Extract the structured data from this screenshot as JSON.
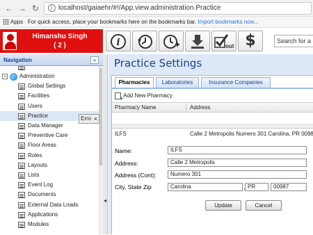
{
  "browser": {
    "url": "localhost/gaiaehr/#!/App.view.administration.Practice",
    "bookmarks": {
      "apps_label": "Apps",
      "message": "For quick access, place your bookmarks here on the bookmarks bar.",
      "import_link": "Import bookmarks now..."
    }
  },
  "header": {
    "user_name": "Himanshu Singh",
    "user_count": "( 2 )",
    "search_placeholder": "Search for a P"
  },
  "toolbar": {
    "info_icon": "info-icon",
    "history_icon": "history-icon",
    "new_clock_icon": "new-clock-icon",
    "download_icon": "download-icon",
    "checkout_label": "out",
    "dollar_label": "$"
  },
  "sidebar": {
    "title": "Navigation",
    "collapse_label": "«",
    "items": [
      {
        "label": "Administration",
        "level": 0
      },
      {
        "label": "Global Settings",
        "level": 1
      },
      {
        "label": "Facilities",
        "level": 1
      },
      {
        "label": "Users",
        "level": 1
      },
      {
        "label": "Practice",
        "level": 1,
        "selected": true
      },
      {
        "label": "Data Manager",
        "level": 1
      },
      {
        "label": "Preventive Care",
        "level": 1
      },
      {
        "label": "Floor Areas",
        "level": 1
      },
      {
        "label": "Roles",
        "level": 1
      },
      {
        "label": "Layouts",
        "level": 1
      },
      {
        "label": "Lists",
        "level": 1
      },
      {
        "label": "Event Log",
        "level": 1
      },
      {
        "label": "Documents",
        "level": 1
      },
      {
        "label": "External Data Loads",
        "level": 1
      },
      {
        "label": "Applications",
        "level": 1
      },
      {
        "label": "Modules",
        "level": 1
      }
    ],
    "tooltip": "Erro",
    "tooltip_close": "×"
  },
  "main": {
    "title": "Practice Settings",
    "tabs": [
      {
        "label": "Pharmacies",
        "active": true
      },
      {
        "label": "Laboratories",
        "active": false
      },
      {
        "label": "Insurance Companies",
        "active": false
      }
    ],
    "add_button": "Add New Pharmacy",
    "grid": {
      "columns": [
        "Pharmacy Name",
        "Address"
      ]
    },
    "detail": {
      "row_name": "ILFS",
      "row_address": "Calle 2 Metropolis Numero 301 Carolina, PR 00987",
      "labels": {
        "name": "Name:",
        "address": "Address:",
        "address_cont": "Address (Cont):",
        "city_state_zip": "City, State Zip"
      },
      "values": {
        "name": "ILFS",
        "address": "Calle 2 Metropolis",
        "address_cont": "Numero 301",
        "city": "Carolina",
        "state": "PR",
        "zip": "00987",
        "separator": ","
      },
      "update_button": "Update",
      "cancel_button": "Cancel"
    }
  },
  "colors": {
    "user_bg": "#e01010",
    "title_blue": "#15428b",
    "panel_bg": "#dfe8f6"
  }
}
